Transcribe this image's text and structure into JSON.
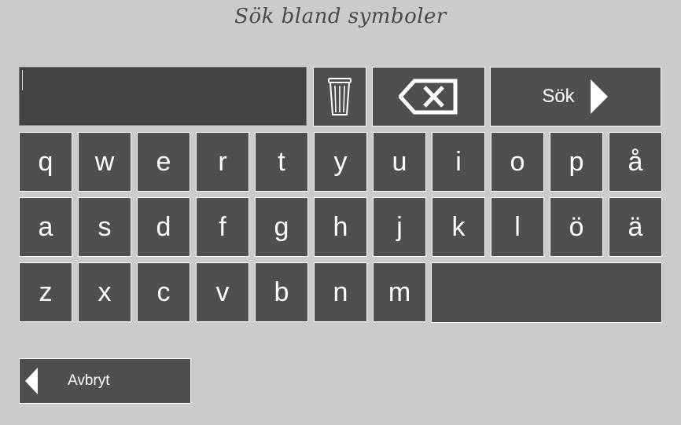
{
  "title": "Sök bland symboler",
  "search": {
    "value": ""
  },
  "actions": {
    "search_label": "Sök",
    "cancel_label": "Avbryt"
  },
  "keyboard": {
    "row1": [
      "q",
      "w",
      "e",
      "r",
      "t",
      "y",
      "u",
      "i",
      "o",
      "p",
      "å"
    ],
    "row2": [
      "a",
      "s",
      "d",
      "f",
      "g",
      "h",
      "j",
      "k",
      "l",
      "ö",
      "ä"
    ],
    "row3": [
      "z",
      "x",
      "c",
      "v",
      "b",
      "n",
      "m"
    ]
  },
  "icons": {
    "clear": "trash-icon",
    "backspace": "backspace-icon",
    "search": "arrow-right-icon",
    "cancel": "arrow-left-icon"
  },
  "colors": {
    "background": "#cbcbcb",
    "key": "#4f4f51",
    "input": "#444444",
    "key_border": "#ffffff"
  }
}
